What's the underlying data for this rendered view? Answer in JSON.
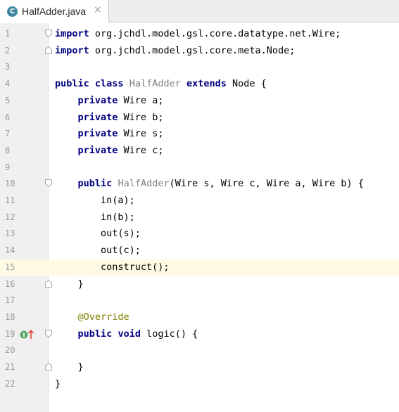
{
  "tab": {
    "icon_letter": "C",
    "title": "HalfAdder.java",
    "close_glyph": "×"
  },
  "lines": [
    {
      "num": "1",
      "indent": "",
      "tokens": [
        {
          "t": "import",
          "c": "kw"
        },
        {
          "t": " org.jchdl.model.gsl.core.datatype.net.Wire;",
          "c": "tok"
        }
      ],
      "fold": "start"
    },
    {
      "num": "2",
      "indent": "",
      "tokens": [
        {
          "t": "import",
          "c": "kw"
        },
        {
          "t": " org.jchdl.model.gsl.core.meta.Node;",
          "c": "tok"
        }
      ],
      "fold": "end"
    },
    {
      "num": "3",
      "indent": "",
      "tokens": []
    },
    {
      "num": "4",
      "indent": "",
      "tokens": [
        {
          "t": "public",
          "c": "kw"
        },
        {
          "t": " ",
          "c": "tok"
        },
        {
          "t": "class",
          "c": "kw"
        },
        {
          "t": " ",
          "c": "tok"
        },
        {
          "t": "HalfAdder",
          "c": "cls"
        },
        {
          "t": " ",
          "c": "tok"
        },
        {
          "t": "extends",
          "c": "kw"
        },
        {
          "t": " Node {",
          "c": "tok"
        }
      ]
    },
    {
      "num": "5",
      "indent": "    ",
      "tokens": [
        {
          "t": "private",
          "c": "kw"
        },
        {
          "t": " Wire a;",
          "c": "tok"
        }
      ]
    },
    {
      "num": "6",
      "indent": "    ",
      "tokens": [
        {
          "t": "private",
          "c": "kw"
        },
        {
          "t": " Wire b;",
          "c": "tok"
        }
      ]
    },
    {
      "num": "7",
      "indent": "    ",
      "tokens": [
        {
          "t": "private",
          "c": "kw"
        },
        {
          "t": " Wire s;",
          "c": "tok"
        }
      ]
    },
    {
      "num": "8",
      "indent": "    ",
      "tokens": [
        {
          "t": "private",
          "c": "kw"
        },
        {
          "t": " Wire c;",
          "c": "tok"
        }
      ]
    },
    {
      "num": "9",
      "indent": "",
      "tokens": []
    },
    {
      "num": "10",
      "indent": "    ",
      "tokens": [
        {
          "t": "public",
          "c": "kw"
        },
        {
          "t": " ",
          "c": "tok"
        },
        {
          "t": "HalfAdder",
          "c": "cls"
        },
        {
          "t": "(Wire s, Wire c, Wire a, Wire b) {",
          "c": "tok"
        }
      ],
      "fold": "start"
    },
    {
      "num": "11",
      "indent": "        ",
      "tokens": [
        {
          "t": "in(a);",
          "c": "tok"
        }
      ]
    },
    {
      "num": "12",
      "indent": "        ",
      "tokens": [
        {
          "t": "in(b);",
          "c": "tok"
        }
      ]
    },
    {
      "num": "13",
      "indent": "        ",
      "tokens": [
        {
          "t": "out(s);",
          "c": "tok"
        }
      ]
    },
    {
      "num": "14",
      "indent": "        ",
      "tokens": [
        {
          "t": "out(c);",
          "c": "tok"
        }
      ]
    },
    {
      "num": "15",
      "indent": "        ",
      "tokens": [
        {
          "t": "construct();",
          "c": "tok"
        }
      ],
      "current": true
    },
    {
      "num": "16",
      "indent": "    ",
      "tokens": [
        {
          "t": "}",
          "c": "tok"
        }
      ],
      "fold": "end"
    },
    {
      "num": "17",
      "indent": "",
      "tokens": []
    },
    {
      "num": "18",
      "indent": "    ",
      "tokens": [
        {
          "t": "@Override",
          "c": "ann"
        }
      ]
    },
    {
      "num": "19",
      "indent": "    ",
      "tokens": [
        {
          "t": "public",
          "c": "kw"
        },
        {
          "t": " ",
          "c": "tok"
        },
        {
          "t": "void",
          "c": "kw"
        },
        {
          "t": " logic() {",
          "c": "tok"
        }
      ],
      "fold": "start",
      "marker": "implements-method-icon"
    },
    {
      "num": "20",
      "indent": "",
      "tokens": []
    },
    {
      "num": "21",
      "indent": "    ",
      "tokens": [
        {
          "t": "}",
          "c": "tok"
        }
      ],
      "fold": "end"
    },
    {
      "num": "22",
      "indent": "",
      "tokens": [
        {
          "t": "}",
          "c": "tok"
        }
      ]
    }
  ],
  "colors": {
    "keyword": "#000080",
    "annotation": "#808000",
    "class_name": "#808080",
    "current_line": "#fffae3",
    "gutter": "#f0f0f0"
  }
}
